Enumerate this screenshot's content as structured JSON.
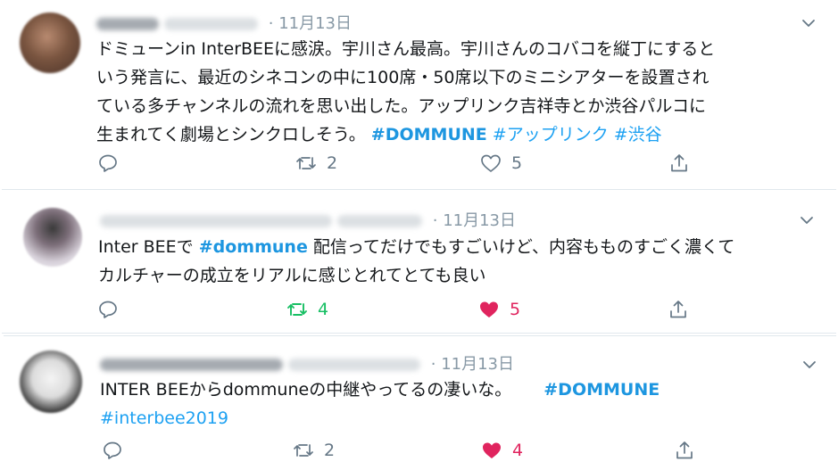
{
  "tweets": [
    {
      "date": "11月13日",
      "text": "ドミューンin InterBEEに感涙。宇川さん最高。宇川さんのコバコを縦丁にするという発言に、最近のシネコンの中に100席・50席以下のミニシアターを設置されている多チャンネルの流れを思い出した。アップリンク吉祥寺とか渋谷パルコに生まれてく劇場とシンクロしそう。",
      "lines": [
        "ドミューンin InterBEEに感涙。宇川さん最高。宇川さんのコバコを縦丁にすると",
        "いう発言に、最近のシネコンの中に100席・50席以下のミニシアターを設置され",
        "ている多チャンネルの流れを思い出した。アップリンク吉祥寺とか渋谷パルコに",
        "生まれてく劇場とシンクロしそう。"
      ],
      "hashtags": [
        "#DOMMUNE",
        "#アップリンク",
        "#渋谷"
      ],
      "replies": "",
      "retweets": "2",
      "likes": "5",
      "liked": false,
      "retweeted": false
    },
    {
      "date": "11月13日",
      "line1_pre": "Inter BEEで ",
      "hashtag": "#dommune",
      "line1_post": " 配信ってだけでもすごいけど、内容もものすごく濃くて",
      "line2": "カルチャーの成立をリアルに感じとれてとても良い",
      "replies": "",
      "retweets": "4",
      "likes": "5",
      "liked": true,
      "retweeted": true
    },
    {
      "date": "11月13日",
      "line1": "INTER BEEからdommuneの中継やってるの凄いな。",
      "hashtag_inline": "#DOMMUNE",
      "hashtag_line2": "#interbee2019",
      "replies": "",
      "retweets": "2",
      "likes": "4",
      "liked": true,
      "retweeted": false
    }
  ],
  "separator": "·",
  "icons": {
    "reply": "reply-icon",
    "retweet": "retweet-icon",
    "like": "heart-icon",
    "share": "share-icon",
    "more": "chevron-down-icon"
  },
  "colors": {
    "link": "#1da1f2",
    "retweet_active": "#17bf63",
    "like_active": "#e0245e",
    "muted": "#8899a6"
  }
}
